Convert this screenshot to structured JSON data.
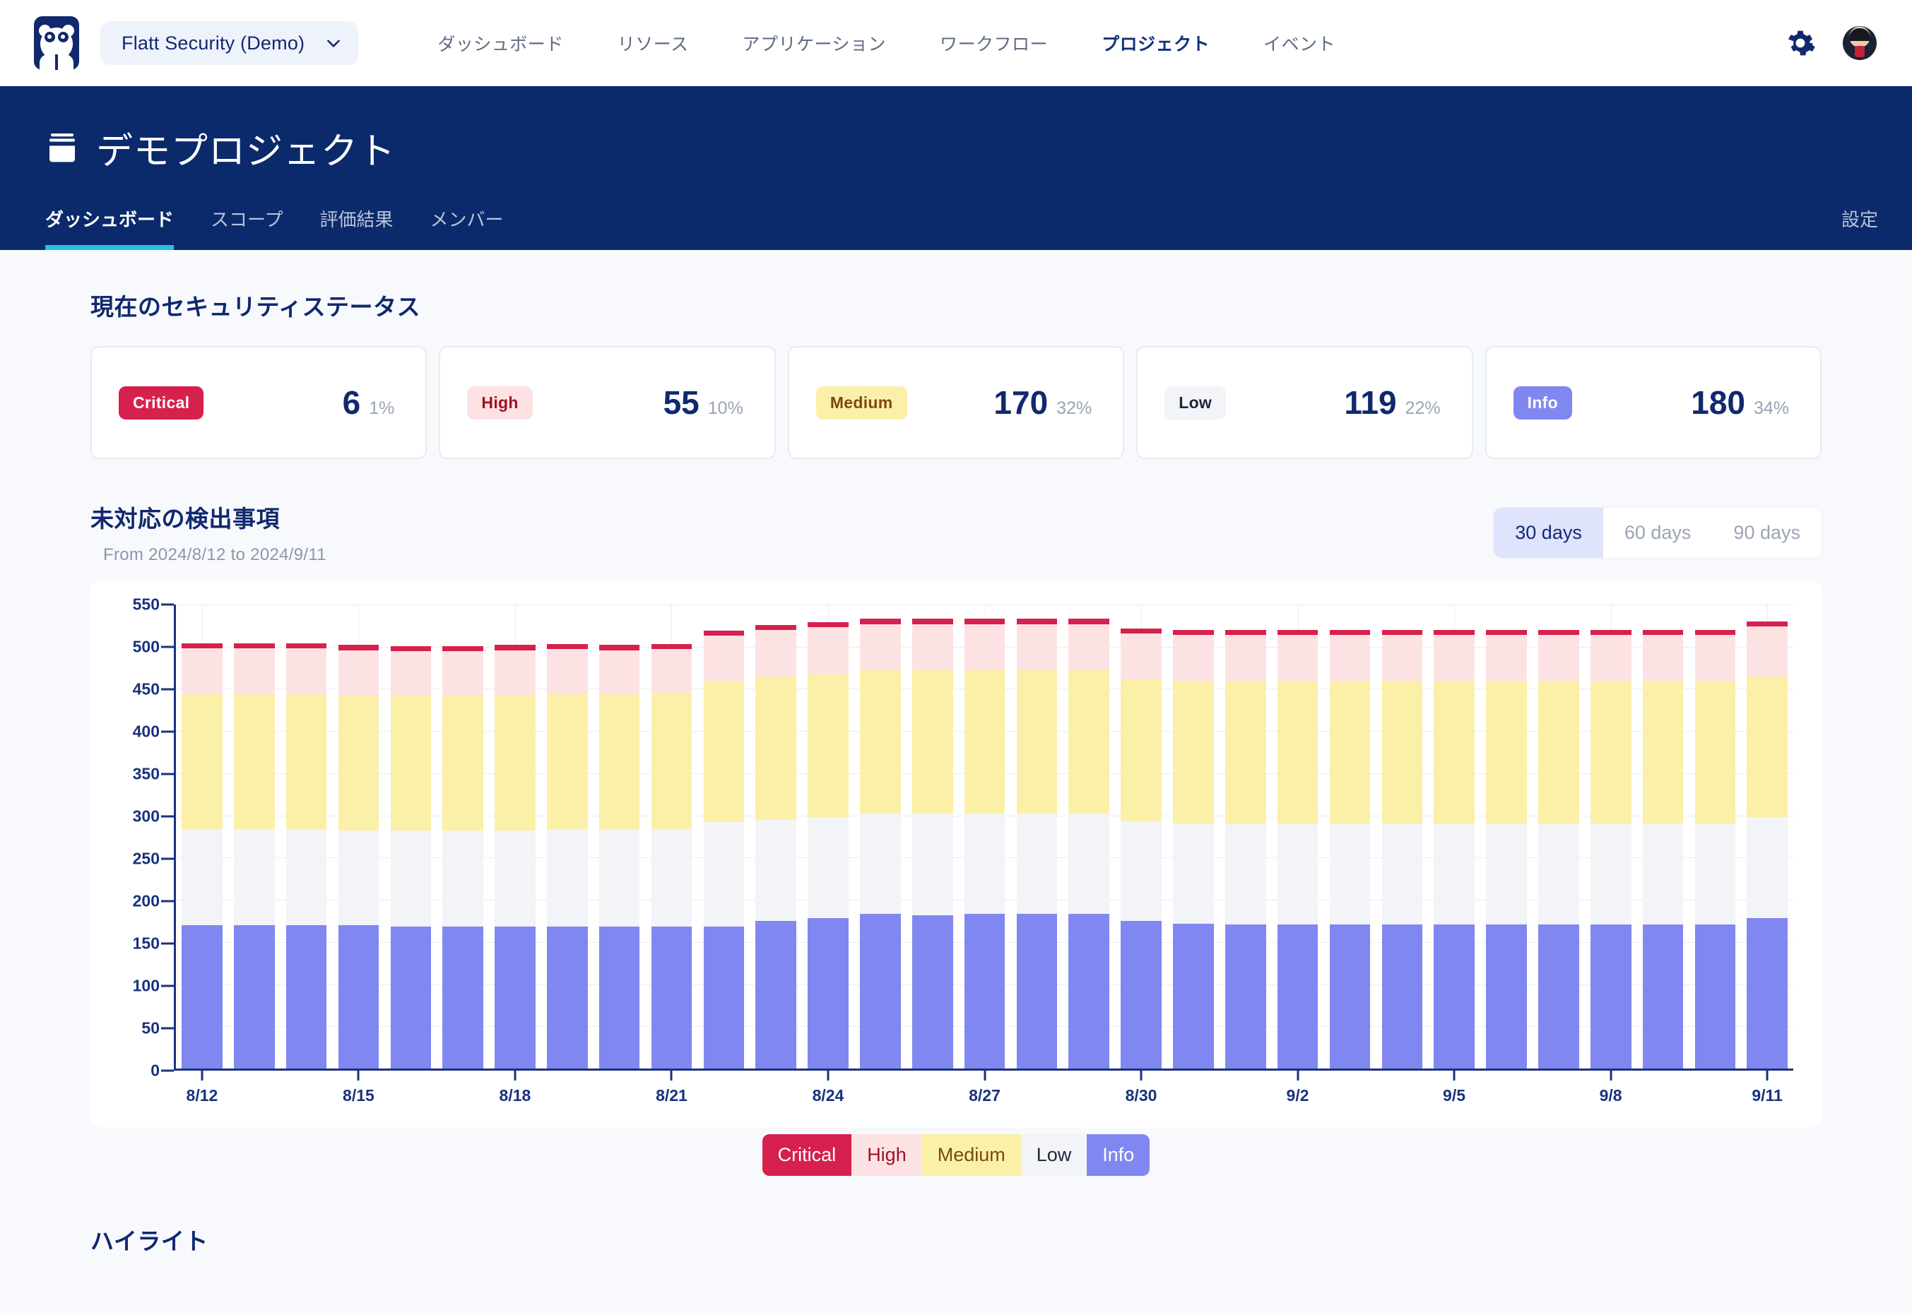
{
  "topbar": {
    "logo_icon": "panda-logo-icon",
    "org_selector": {
      "label": "Flatt Security (Demo)",
      "chevron_icon": "chevron-down-icon"
    },
    "nav": [
      {
        "label": "ダッシュボード",
        "active": false
      },
      {
        "label": "リソース",
        "active": false
      },
      {
        "label": "アプリケーション",
        "active": false
      },
      {
        "label": "ワークフロー",
        "active": false
      },
      {
        "label": "プロジェクト",
        "active": true
      },
      {
        "label": "イベント",
        "active": false
      }
    ],
    "settings_icon": "gear-icon",
    "avatar_icon": "user-avatar"
  },
  "project_header": {
    "icon": "project-stack-icon",
    "title": "デモプロジェクト",
    "tabs": [
      {
        "label": "ダッシュボード",
        "active": true
      },
      {
        "label": "スコープ",
        "active": false
      },
      {
        "label": "評価結果",
        "active": false
      },
      {
        "label": "メンバー",
        "active": false
      }
    ],
    "settings_link": "設定"
  },
  "status_section": {
    "title": "現在のセキュリティステータス",
    "cards": [
      {
        "severity": "Critical",
        "count": "6",
        "percent": "1%",
        "bg": "#d6204d",
        "fg": "#ffffff"
      },
      {
        "severity": "High",
        "count": "55",
        "percent": "10%",
        "bg": "#fde2e4",
        "fg": "#9f1226"
      },
      {
        "severity": "Medium",
        "count": "170",
        "percent": "32%",
        "bg": "#fbf0a8",
        "fg": "#7a4a10"
      },
      {
        "severity": "Low",
        "count": "119",
        "percent": "22%",
        "bg": "#f2f4f7",
        "fg": "#20283a"
      },
      {
        "severity": "Info",
        "count": "180",
        "percent": "34%",
        "bg": "#8187f0",
        "fg": "#ffffff"
      }
    ]
  },
  "chart_section": {
    "title": "未対応の検出事項",
    "subtitle": "From 2024/8/12 to 2024/9/11",
    "range_buttons": [
      {
        "label": "30 days",
        "active": true
      },
      {
        "label": "60 days",
        "active": false
      },
      {
        "label": "90 days",
        "active": false
      }
    ]
  },
  "highlight_section": {
    "title": "ハイライト"
  },
  "chart_data": {
    "type": "bar",
    "stacked": true,
    "title": "未対応の検出事項",
    "subtitle": "From 2024/8/12 to 2024/9/11",
    "xlabel": "",
    "ylabel": "",
    "ylim": [
      0,
      550
    ],
    "yticks": [
      0,
      50,
      100,
      150,
      200,
      250,
      300,
      350,
      400,
      450,
      500,
      550
    ],
    "grid": true,
    "legend_position": "bottom",
    "x": [
      "8/12",
      "8/13",
      "8/14",
      "8/15",
      "8/16",
      "8/17",
      "8/18",
      "8/19",
      "8/20",
      "8/21",
      "8/22",
      "8/23",
      "8/24",
      "8/25",
      "8/26",
      "8/27",
      "8/28",
      "8/29",
      "8/30",
      "8/31",
      "9/1",
      "9/2",
      "9/3",
      "9/4",
      "9/5",
      "9/6",
      "9/7",
      "9/8",
      "9/9",
      "9/10",
      "9/11"
    ],
    "xtick_labels": [
      "8/12",
      "8/15",
      "8/18",
      "8/21",
      "8/24",
      "8/27",
      "8/30",
      "9/2",
      "9/5",
      "9/8",
      "9/11"
    ],
    "series": [
      {
        "name": "Info",
        "color": "#8187f0",
        "values": [
          170,
          170,
          170,
          170,
          168,
          168,
          168,
          168,
          168,
          168,
          168,
          175,
          178,
          183,
          182,
          183,
          183,
          183,
          175,
          172,
          171,
          171,
          171,
          171,
          171,
          171,
          171,
          171,
          171,
          171,
          178
        ]
      },
      {
        "name": "Low",
        "color": "#f2f4f7",
        "values": [
          114,
          114,
          114,
          112,
          114,
          114,
          114,
          115,
          115,
          116,
          124,
          120,
          119,
          119,
          120,
          119,
          119,
          119,
          118,
          118,
          119,
          119,
          119,
          119,
          119,
          119,
          119,
          119,
          119,
          119,
          120
        ]
      },
      {
        "name": "Medium",
        "color": "#fbf0a8",
        "values": [
          160,
          160,
          160,
          160,
          160,
          160,
          161,
          161,
          161,
          161,
          168,
          170,
          170,
          170,
          170,
          170,
          170,
          170,
          168,
          170,
          170,
          170,
          170,
          170,
          170,
          170,
          170,
          170,
          170,
          170,
          167
        ]
      },
      {
        "name": "High",
        "color": "#fde2e4",
        "values": [
          54,
          54,
          54,
          54,
          53,
          53,
          53,
          53,
          52,
          52,
          53,
          55,
          56,
          55,
          55,
          55,
          55,
          55,
          55,
          54,
          54,
          54,
          54,
          54,
          54,
          54,
          54,
          54,
          54,
          54,
          59
        ]
      },
      {
        "name": "Critical",
        "color": "#d6204d",
        "values": [
          6,
          6,
          6,
          6,
          6,
          6,
          6,
          6,
          6,
          6,
          6,
          6,
          6,
          6,
          6,
          6,
          6,
          6,
          6,
          6,
          6,
          6,
          6,
          6,
          6,
          6,
          6,
          6,
          6,
          6,
          6
        ]
      }
    ],
    "legend": [
      {
        "label": "Critical",
        "bg": "#d6204d",
        "fg": "#ffffff"
      },
      {
        "label": "High",
        "bg": "#fde2e4",
        "fg": "#9f1226"
      },
      {
        "label": "Medium",
        "bg": "#fbf0a8",
        "fg": "#7a4a10"
      },
      {
        "label": "Low",
        "bg": "#f2f4f7",
        "fg": "#20283a"
      },
      {
        "label": "Info",
        "bg": "#8187f0",
        "fg": "#ffffff"
      }
    ]
  }
}
